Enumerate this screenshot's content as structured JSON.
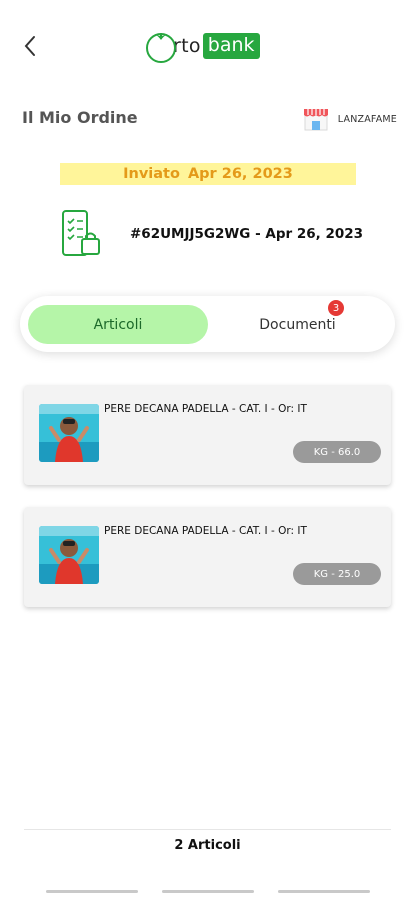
{
  "header": {
    "logo_part1": "rto",
    "logo_part2": "bank",
    "page_title": "Il Mio Ordine",
    "store_name": "LANZAFAME"
  },
  "status": {
    "label": "Inviato",
    "date": "Apr 26, 2023"
  },
  "order": {
    "code": "#62UMJJ5G2WG - Apr 26, 2023"
  },
  "tabs": {
    "articles": "Articoli",
    "documents": "Documenti",
    "documents_badge": "3"
  },
  "items": [
    {
      "name": "PERE DECANA PADELLA - CAT. I - Or: IT",
      "quantity": "KG - 66.0"
    },
    {
      "name": "PERE DECANA PADELLA - CAT. I - Or: IT",
      "quantity": "KG - 25.0"
    }
  ],
  "footer": {
    "count": "2 Articoli"
  },
  "colors": {
    "brand_green": "#27a73f",
    "tab_active": "#b5f5a8",
    "status_bg": "#fff59a",
    "status_text": "#e49a1a",
    "badge_red": "#e53935"
  },
  "icons": [
    "back-arrow-icon",
    "tomato-logo-icon",
    "store-icon",
    "mobile-order-icon"
  ]
}
